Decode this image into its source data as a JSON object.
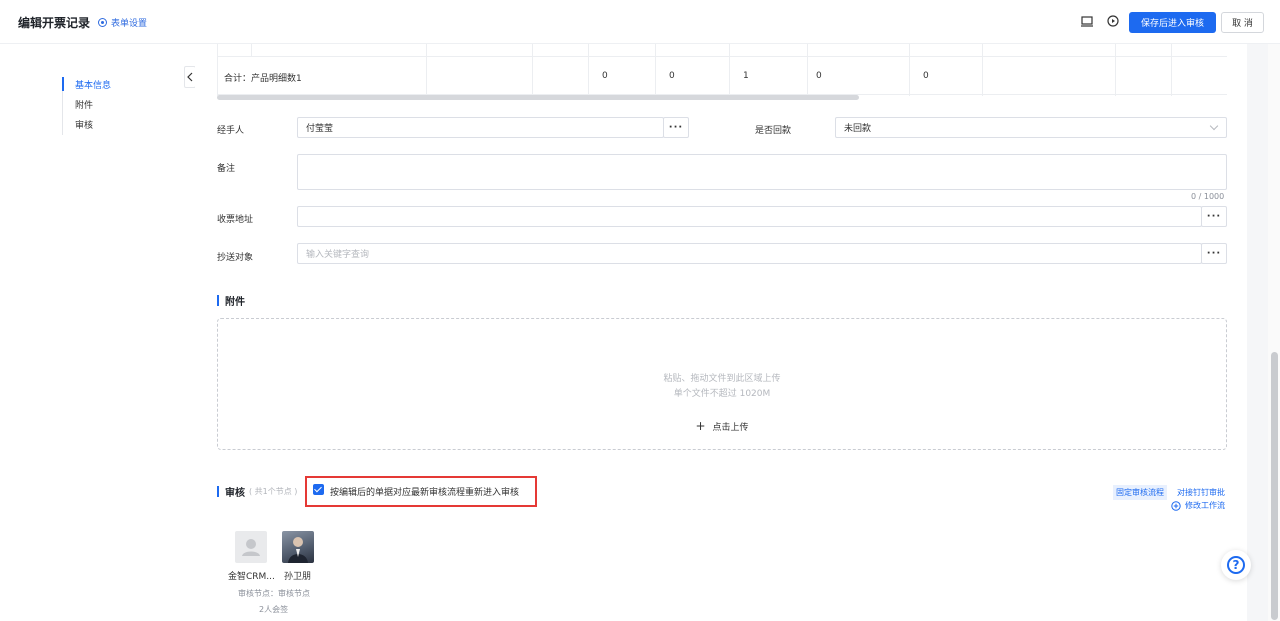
{
  "header": {
    "title": "编辑开票记录",
    "form_settings": "表单设置",
    "save_label": "保存后进入审核",
    "cancel_label": "取 消"
  },
  "sidebar": {
    "items": [
      {
        "label": "基本信息",
        "active": true
      },
      {
        "label": "附件",
        "active": false
      },
      {
        "label": "审核",
        "active": false
      }
    ]
  },
  "detail_table": {
    "summary_label": "合计：产品明细数1",
    "summary_values": [
      "0",
      "0",
      "1",
      "0",
      "0"
    ]
  },
  "form": {
    "handler_label": "经手人",
    "handler_value": "付莹莹",
    "payment_label": "是否回款",
    "payment_value": "未回款",
    "remark_label": "备注",
    "remark_counter": "0 / 1000",
    "address_label": "收票地址",
    "address_value": "",
    "cc_label": "抄送对象",
    "cc_placeholder": "输入关键字查询",
    "more_glyph": "···"
  },
  "attachment": {
    "title": "附件",
    "hint_line1": "粘贴、拖动文件到此区域上传",
    "hint_line2": "单个文件不超过 1020M",
    "upload_label": "点击上传",
    "plus_glyph": "+"
  },
  "review": {
    "title": "审核",
    "node_count": "( 共1个节点 )",
    "reenter_checkbox_label": "按编辑后的单据对应最新审核流程重新进入审核",
    "reenter_checked": true,
    "fixed_flow_tag": "固定审核流程",
    "dingtalk_link": "对接钉钉审批",
    "modify_workflow": "修改工作流",
    "approvers": [
      {
        "name": "金智CRM...",
        "avatar": "placeholder"
      },
      {
        "name": "孙卫朋",
        "avatar": "photo"
      }
    ],
    "node_info": "审核节点：审核节点",
    "sign_mode": "2人会签"
  },
  "colors": {
    "primary": "#1d6af0",
    "highlight_frame": "#e53935"
  },
  "icons": {
    "monitor": "monitor-icon",
    "play": "play-circle-icon",
    "help": "help-icon",
    "settings": "gear-icon"
  }
}
